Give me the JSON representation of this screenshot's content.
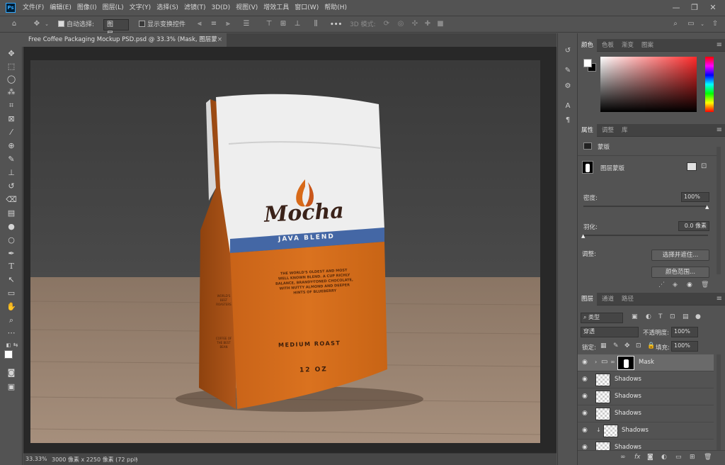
{
  "menubar": {
    "logo": "Ps",
    "items": [
      "文件(F)",
      "编辑(E)",
      "图像(I)",
      "图层(L)",
      "文字(Y)",
      "选择(S)",
      "滤镜(T)",
      "3D(D)",
      "视图(V)",
      "增效工具",
      "窗口(W)",
      "帮助(H)"
    ],
    "minimize": "—",
    "restore": "❐",
    "close": "✕"
  },
  "options": {
    "auto_select_label": "自动选择:",
    "auto_select_value": "图层",
    "show_transform_label": "显示变换控件",
    "mode_3d_label": "3D 模式:",
    "more": "•••"
  },
  "document": {
    "tab_title": "Free Coffee Packaging Mockup PSD.psd @ 33.3% (Mask, 图层蒙版/8)",
    "tab_close": "×",
    "zoom": "33.33%",
    "size_info": "3000 像素 x 2250 像素 (72 ppi)",
    "arrow": "›"
  },
  "artwork": {
    "brand": "Mocha",
    "blend": "JAVA BLEND",
    "description": [
      "THE WORLD'S OLDEST AND MOST",
      "WELL KNOWN BLEND. A CUP RICHLY",
      "BALANCE, BRANDY-TONED CHOCOLATE,",
      "WITH NUTTY ALMOND AND DEEPER",
      "HINTS OF BLUEBERRY"
    ],
    "roast": "MEDIUM ROAST",
    "weight": "12 OZ",
    "side_text_1": "WORLD'S BEST ROASTERS",
    "side_text_2": "COFFEE OF THE BEST BEAN"
  },
  "color_panel": {
    "tabs": [
      "颜色",
      "色板",
      "渐变",
      "图案"
    ],
    "hue_color": "#ff2a2a"
  },
  "properties_panel": {
    "tabs": [
      "属性",
      "调整",
      "库"
    ],
    "section_label": "蒙版",
    "layer_mask_label": "图层蒙版",
    "density_label": "密度:",
    "density_value": "100%",
    "feather_label": "羽化:",
    "feather_value": "0.0 像素",
    "refine_label": "调整:",
    "select_mask_btn": "选择并遮住...",
    "color_range_btn": "颜色范围..."
  },
  "layers_panel": {
    "tabs": [
      "图层",
      "通道",
      "路径"
    ],
    "filter_label": "类型",
    "blend_mode": "穿透",
    "opacity_label": "不透明度:",
    "opacity_value": "100%",
    "lock_label": "锁定:",
    "fill_label": "填充:",
    "fill_value": "100%",
    "layers": [
      {
        "name": "Mask",
        "type": "group",
        "selected": true
      },
      {
        "name": "Shadows",
        "type": "layer",
        "selected": false
      },
      {
        "name": "Shadows",
        "type": "layer",
        "selected": false
      },
      {
        "name": "Shadows",
        "type": "layer",
        "selected": false
      },
      {
        "name": "Shadows",
        "type": "clipped",
        "selected": false
      },
      {
        "name": "Shadows",
        "type": "layer",
        "selected": false
      }
    ],
    "bottom_icons": [
      "link-icon",
      "fx-icon",
      "mask-icon",
      "adjustment-icon",
      "folder-icon",
      "new-layer-icon",
      "trash-icon"
    ],
    "fx_label": "fx"
  }
}
